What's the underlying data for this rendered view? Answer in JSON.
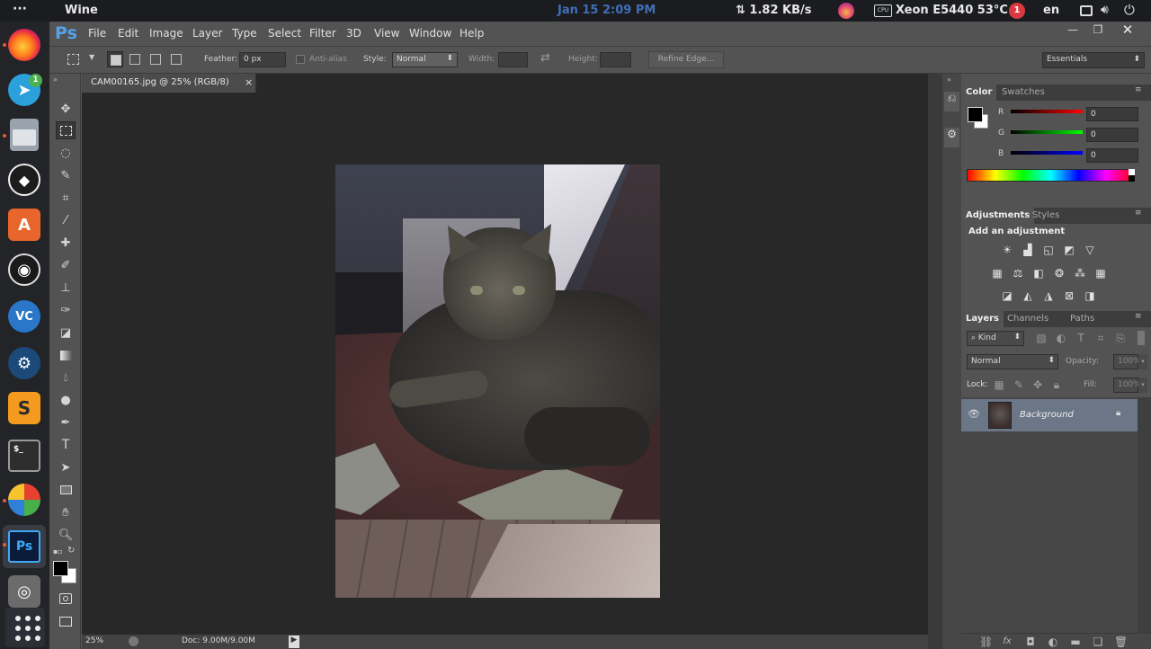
{
  "topbar": {
    "app_title": "Wine",
    "datetime": "Jan 15   2:09 PM",
    "net_speed": "⇅ 1.82 KB/s",
    "cpu": "Xeon E5440 53°C",
    "lang": "en",
    "notif_count": "1"
  },
  "dock": {
    "telegram_badge": "1",
    "vc_label": "VC",
    "ps_label": "Ps"
  },
  "ps": {
    "logo": "Ps",
    "menu": [
      "File",
      "Edit",
      "Image",
      "Layer",
      "Type",
      "Select",
      "Filter",
      "3D",
      "View",
      "Window",
      "Help"
    ],
    "options": {
      "feather_label": "Feather:",
      "feather_value": "0 px",
      "antialias_label": "Anti-alias",
      "style_label": "Style:",
      "style_value": "Normal",
      "width_label": "Width:",
      "height_label": "Height:",
      "refine_label": "Refine Edge...",
      "workspace_value": "Essentials"
    },
    "doc_tab": "CAM00165.jpg @ 25% (RGB/8)",
    "doc_close": "×",
    "status": {
      "zoom": "25%",
      "doc": "Doc: 9.00M/9.00M"
    },
    "color_panel": {
      "tab_color": "Color",
      "tab_swatches": "Swatches",
      "r_label": "R",
      "g_label": "G",
      "b_label": "B",
      "r_value": "0",
      "g_value": "0",
      "b_value": "0"
    },
    "adjust_panel": {
      "tab_adjustments": "Adjustments",
      "tab_styles": "Styles",
      "heading": "Add an adjustment"
    },
    "layers_panel": {
      "tab_layers": "Layers",
      "tab_channels": "Channels",
      "tab_paths": "Paths",
      "kind_label": "Kind",
      "blend_value": "Normal",
      "opacity_label": "Opacity:",
      "opacity_value": "100%",
      "lock_label": "Lock:",
      "fill_label": "Fill:",
      "fill_value": "100%",
      "layer_name": "Background"
    }
  }
}
